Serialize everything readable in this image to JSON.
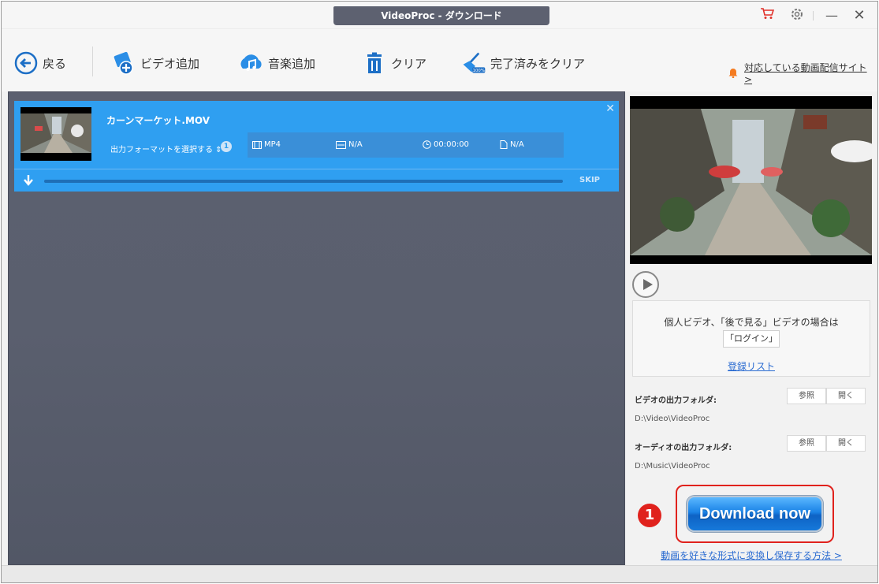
{
  "window": {
    "title": "VideoProc - ダウンロード",
    "controls": {
      "minimize": "—",
      "close": "✕"
    }
  },
  "toolbar": {
    "back_label": "戻る",
    "add_video_label": "ビデオ追加",
    "add_music_label": "音楽追加",
    "clear_label": "クリア",
    "clear_done_label": "完了済みをクリア",
    "supported_sites_label": "対応している動画配信サイト >"
  },
  "download_item": {
    "filename": "カーンマーケット.MOV",
    "format_selector_label": "出力フォーマットを選択する ⇕",
    "format_count": "1",
    "format": "MP4",
    "resolution": "N/A",
    "duration": "00:00:00",
    "size": "N/A",
    "skip_label": "SKIP",
    "progress": 0
  },
  "sidebar": {
    "login_prompt": "個人ビデオ、「後で見る」ビデオの場合は",
    "login_button": "「ログイン」",
    "registered_list_link": "登録リスト",
    "video_folder_label": "ビデオの出力フォルダ:",
    "video_folder_path": "D:\\Video\\VideoProc",
    "audio_folder_label": "オーディオの出力フォルダ:",
    "audio_folder_path": "D:\\Music\\VideoProc",
    "browse_label": "参照",
    "open_label": "開く",
    "download_button": "Download now",
    "step_number": "1",
    "howto_link": "動画を好きな形式に変換し保存する方法 >"
  },
  "colors": {
    "accent_blue": "#2f9ff1",
    "panel_gray": "#5a5f6e",
    "highlight_red": "#e0221d",
    "link_blue": "#2a6bd1"
  },
  "icons": [
    "back-arrow-icon",
    "add-video-icon",
    "add-music-icon",
    "trash-icon",
    "broom-icon",
    "bell-icon",
    "cart-icon",
    "settings-gear-icon",
    "film-icon",
    "resolution-icon",
    "clock-icon",
    "file-icon",
    "download-arrow-icon",
    "play-icon"
  ]
}
